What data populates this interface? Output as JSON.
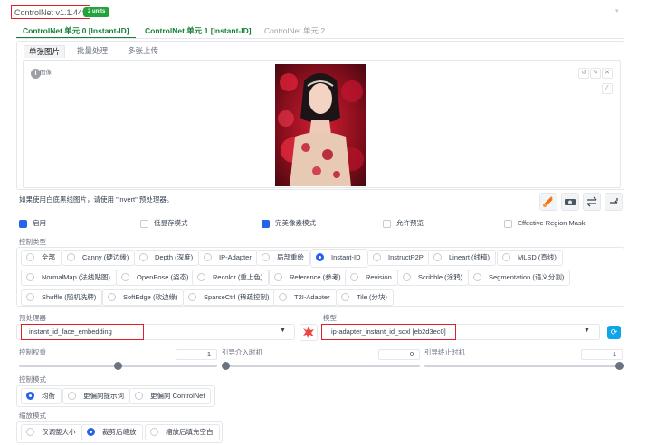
{
  "header": {
    "title": "ControlNet v1.1.449",
    "badge": "2 units"
  },
  "main_tabs": [
    {
      "label": "ControlNet 单元 0 [Instant-ID]"
    },
    {
      "label": "ControlNet 单元 1 [Instant-ID]"
    },
    {
      "label": "ControlNet 单元 2"
    }
  ],
  "sub_tabs": [
    {
      "label": "单张图片"
    },
    {
      "label": "批量处理"
    },
    {
      "label": "多张上传"
    }
  ],
  "image_panel": {
    "label": "图像"
  },
  "hint": "如果使用白底黑线图片，请使用 \"invert\" 预处理器。",
  "options": {
    "enable": {
      "label": "启用",
      "checked": true
    },
    "low_vram": {
      "label": "低显存模式",
      "checked": false
    },
    "pixel_perfect": {
      "label": "完美像素模式",
      "checked": true
    },
    "allow_preview": {
      "label": "允许预览",
      "checked": false
    },
    "effective_region_mask": {
      "label": "Effective Region Mask",
      "checked": false
    }
  },
  "control_type": {
    "label": "控制类型",
    "selected": "Instant-ID",
    "rows": [
      [
        "全部",
        "Canny (硬边缘)",
        "Depth (深度)",
        "IP-Adapter",
        "局部重绘",
        "Instant-ID",
        "InstructP2P",
        "Lineart (线稿)",
        "MLSD (直线)"
      ],
      [
        "NormalMap (法线贴图)",
        "OpenPose (姿态)",
        "Recolor (重上色)",
        "Reference (参考)",
        "Revision",
        "Scribble (涂鸦)",
        "Segmentation (语义分割)"
      ],
      [
        "Shuffle (随机洗牌)",
        "SoftEdge (软边缘)",
        "SparseCtrl (稀疏控制)",
        "T2I-Adapter",
        "Tile (分块)"
      ]
    ]
  },
  "preprocessor": {
    "label": "预处理器",
    "value": "instant_id_face_embedding"
  },
  "model": {
    "label": "模型",
    "value": "ip-adapter_instant_id_sdxl [eb2d3ec0]"
  },
  "sliders": {
    "weight": {
      "label": "控制权重",
      "value": "1",
      "fraction": 0.5
    },
    "start": {
      "label": "引导介入时机",
      "value": "0",
      "fraction": 0.0
    },
    "end": {
      "label": "引导终止时机",
      "value": "1",
      "fraction": 1.0
    }
  },
  "control_mode": {
    "label": "控制模式",
    "selected": "均衡",
    "options": [
      "均衡",
      "更偏向提示词",
      "更偏向 ControlNet"
    ]
  },
  "resize_mode": {
    "label": "缩放模式",
    "selected": "裁剪后缩放",
    "options": [
      "仅调整大小",
      "裁剪后缩放",
      "缩放后填充空白"
    ]
  },
  "colors": {
    "accent": "#2563eb",
    "green": "#16803a",
    "badge": "#22a33b",
    "red_box": "#e11d2a",
    "orange_icon": "#f97316",
    "blue_icon": "#0ea5e9"
  }
}
